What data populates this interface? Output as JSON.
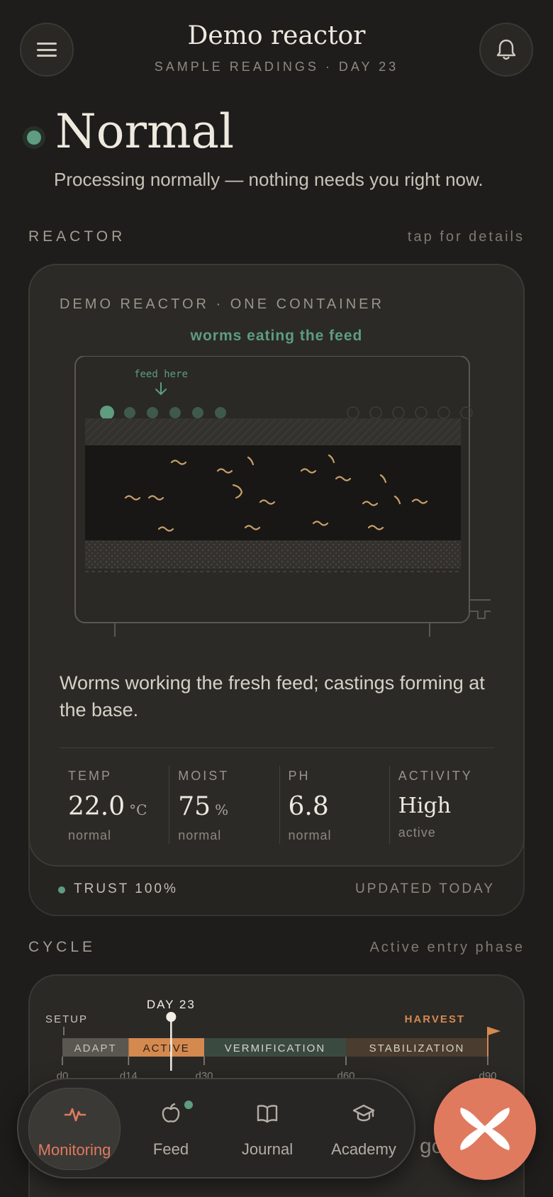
{
  "header": {
    "title": "Demo reactor",
    "subtitle": "SAMPLE READINGS · DAY 23"
  },
  "status": {
    "title": "Normal",
    "description": "Processing normally — nothing needs you right now."
  },
  "reactor_section": {
    "label": "REACTOR",
    "hint": "tap for details"
  },
  "reactor_card": {
    "kicker": "DEMO REACTOR · ONE CONTAINER",
    "state": "worms eating the feed",
    "feed_hint": "feed here",
    "description": "Worms working the fresh feed; castings forming at the base.",
    "metrics": [
      {
        "label": "TEMP",
        "value": "22.0",
        "unit": "°C",
        "status": "normal"
      },
      {
        "label": "MOIST",
        "value": "75",
        "unit": "%",
        "status": "normal"
      },
      {
        "label": "PH",
        "value": "6.8",
        "unit": "",
        "status": "normal"
      },
      {
        "label": "ACTIVITY",
        "value": "High",
        "unit": "",
        "status": "active"
      }
    ],
    "trust": "TRUST 100%",
    "updated": "UPDATED TODAY"
  },
  "cycle_section": {
    "label": "CYCLE",
    "hint": "Active entry phase"
  },
  "cycle": {
    "current_day": 23,
    "total_days": 90,
    "current_label": "DAY 23",
    "start_label": "SETUP",
    "end_label": "HARVEST",
    "phases": [
      {
        "name": "ADAPT",
        "start": 0,
        "end": 14,
        "color": "#5a5650",
        "text_color": "#c9c4ba"
      },
      {
        "name": "ACTIVE",
        "start": 14,
        "end": 30,
        "color": "#d4894f",
        "text_color": "#2a1c12"
      },
      {
        "name": "VERMIFICATION",
        "start": 30,
        "end": 60,
        "color": "#3b4a41",
        "text_color": "#d8d3c8"
      },
      {
        "name": "STABILIZATION",
        "start": 60,
        "end": 90,
        "color": "#4a3c2e",
        "text_color": "#d8d3c8"
      }
    ],
    "ticks": [
      "d0",
      "d14",
      "d30",
      "d60",
      "d90"
    ],
    "tick_days": [
      0,
      14,
      30,
      60,
      90
    ]
  },
  "nav": {
    "items": [
      {
        "label": "Monitoring",
        "icon": "pulse-icon",
        "active": true
      },
      {
        "label": "Feed",
        "icon": "apple-icon",
        "active": false,
        "badge": true
      },
      {
        "label": "Journal",
        "icon": "book-icon",
        "active": false
      },
      {
        "label": "Academy",
        "icon": "graduation-cap-icon",
        "active": false
      }
    ],
    "peek_text": "go"
  },
  "colors": {
    "accent": "#e07a5f",
    "ok": "#5e9d7f",
    "harvest": "#d4894f",
    "background": "#1e1d1b"
  }
}
